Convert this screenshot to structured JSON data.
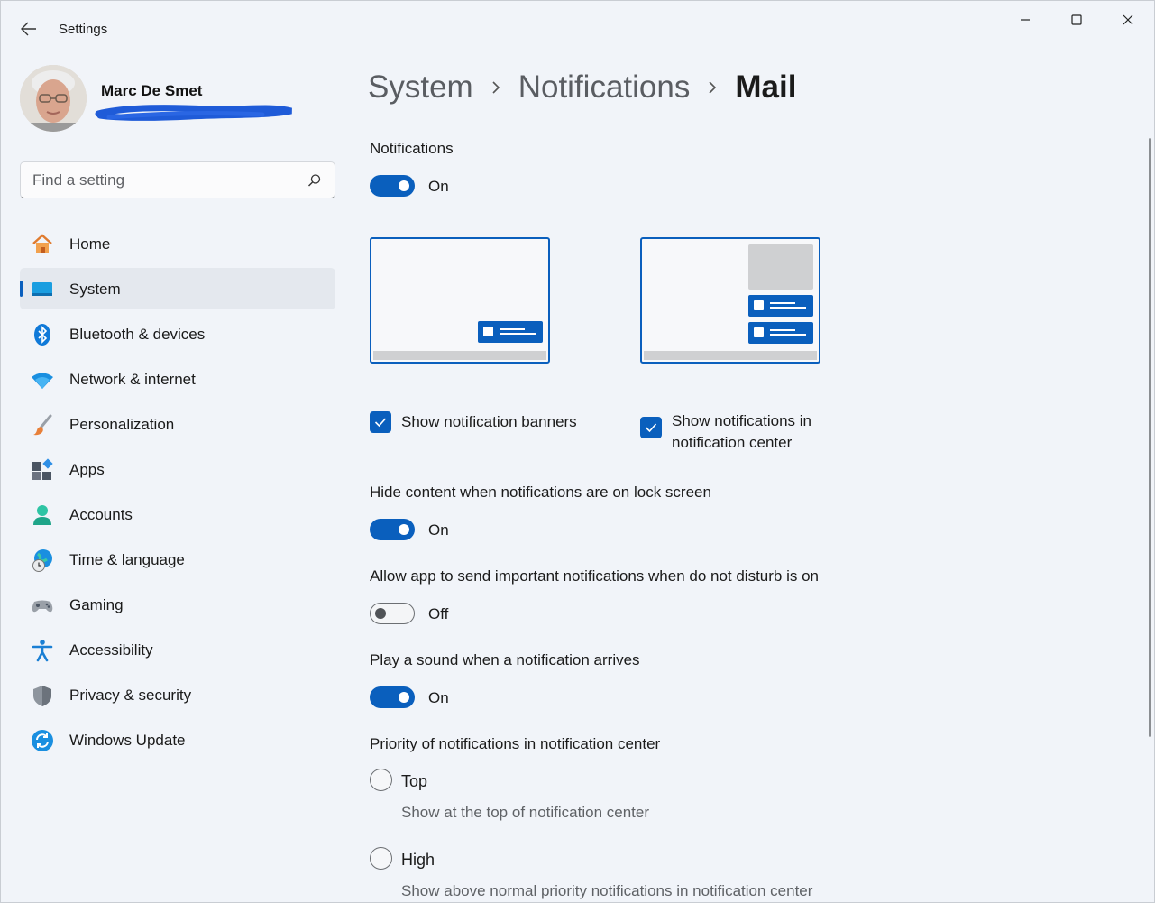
{
  "window": {
    "title": "Settings"
  },
  "profile": {
    "name": "Marc De Smet"
  },
  "search": {
    "placeholder": "Find a setting"
  },
  "nav": {
    "items": [
      {
        "label": "Home",
        "icon": "home-icon"
      },
      {
        "label": "System",
        "icon": "system-icon",
        "active": true
      },
      {
        "label": "Bluetooth & devices",
        "icon": "bluetooth-icon"
      },
      {
        "label": "Network & internet",
        "icon": "wifi-icon"
      },
      {
        "label": "Personalization",
        "icon": "paintbrush-icon"
      },
      {
        "label": "Apps",
        "icon": "apps-icon"
      },
      {
        "label": "Accounts",
        "icon": "accounts-icon"
      },
      {
        "label": "Time & language",
        "icon": "globe-clock-icon"
      },
      {
        "label": "Gaming",
        "icon": "gamepad-icon"
      },
      {
        "label": "Accessibility",
        "icon": "accessibility-icon"
      },
      {
        "label": "Privacy & security",
        "icon": "shield-icon"
      },
      {
        "label": "Windows Update",
        "icon": "update-icon"
      }
    ]
  },
  "breadcrumb": {
    "items": [
      "System",
      "Notifications",
      "Mail"
    ]
  },
  "settings": {
    "notifications_label": "Notifications",
    "notifications_state": "On",
    "show_banners_label": "Show notification banners",
    "show_center_label_line1": "Show notifications in",
    "show_center_label_line2": "notification center",
    "hide_content_label": "Hide content when notifications are on lock screen",
    "hide_content_state": "On",
    "dnd_label": "Allow app to send important notifications when do not disturb is on",
    "dnd_state": "Off",
    "sound_label": "Play a sound when a notification arrives",
    "sound_state": "On",
    "priority_label": "Priority of notifications in notification center",
    "priority_options": [
      {
        "label": "Top",
        "description": "Show at the top of notification center"
      },
      {
        "label": "High",
        "description": "Show above normal priority notifications in notification center"
      }
    ]
  },
  "colors": {
    "accent": "#0a5fbd",
    "background": "#f1f4f9"
  }
}
